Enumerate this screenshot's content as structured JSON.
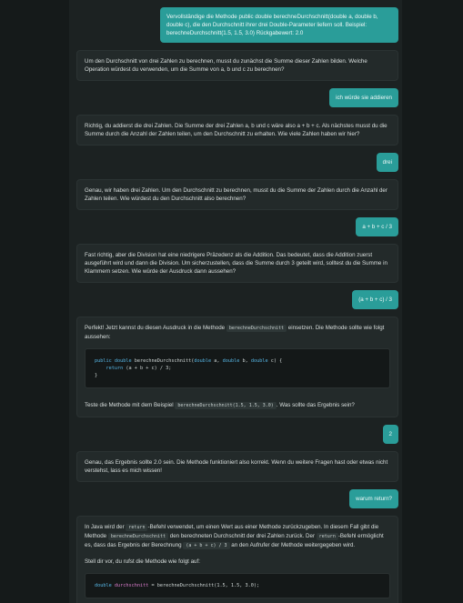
{
  "messages": [
    {
      "role": "user",
      "text": "Vervollständige die Methode public double berechneDurchschnitt(double a, double b, double c), die den Durchschnitt ihrer drei Double-Parameter liefern soll. Beispiel: berechneDurchschnitt(1.5, 1.5, 3.0) Rückgabewert: 2.0"
    },
    {
      "role": "assistant",
      "text": "Um den Durchschnitt von drei Zahlen zu berechnen, musst du zunächst die Summe dieser Zahlen bilden. Welche Operation würdest du verwenden, um die Summe von a, b und c zu berechnen?"
    },
    {
      "role": "user",
      "text": "ich würde sie addieren"
    },
    {
      "role": "assistant",
      "text": "Richtig, du addierst die drei Zahlen. Die Summe der drei Zahlen a, b und c wäre also a + b + c. Als nächstes musst du die Summe durch die Anzahl der Zahlen teilen, um den Durchschnitt zu erhalten. Wie viele Zahlen haben wir hier?"
    },
    {
      "role": "user",
      "text": "drei"
    },
    {
      "role": "assistant",
      "text": "Genau, wir haben drei Zahlen. Um den Durchschnitt zu berechnen, musst du die Summe der Zahlen durch die Anzahl der Zahlen teilen. Wie würdest du den Durchschnitt also berechnen?"
    },
    {
      "role": "user",
      "text": "a + b + c / 3"
    },
    {
      "role": "assistant",
      "text": "Fast richtig, aber die Division hat eine niedrigere Präzedenz als die Addition. Das bedeutet, dass die Addition zuerst ausgeführt wird und dann die Division. Um sicherzustellen, dass die Summe durch 3 geteilt wird, solltest du die Summe in Klammern setzen. Wie würde der Ausdruck dann aussehen?"
    },
    {
      "role": "user",
      "text": "(a + b + c) / 3"
    },
    {
      "role": "assistant",
      "p1_before": "Perfekt! Jetzt kannst du diesen Ausdruck in die Methode",
      "p1_code": "berechneDurchschnitt",
      "p1_after": "einsetzen. Die Methode sollte wie folgt aussehen:",
      "code": {
        "l1_kw": "public",
        "l1_ty": "double",
        "l1_name": "berechneDurchschnitt(",
        "l1_t1": "double",
        "l1_a": "a, ",
        "l1_t2": "double",
        "l1_b": "b, ",
        "l1_t3": "double",
        "l1_c": "c) {",
        "l2_kw": "return",
        "l2_expr": "(a + b + c) / 3;",
        "l3": "}"
      },
      "p2_before": "Teste die Methode mit dem Beispiel",
      "p2_code": "berechneDurchschnitt(1.5, 1.5, 3.0)",
      "p2_after": ". Was sollte das Ergebnis sein?"
    },
    {
      "role": "user",
      "text": "2"
    },
    {
      "role": "assistant",
      "text": "Genau, das Ergebnis sollte 2.0 sein. Die Methode funktioniert also korrekt. Wenn du weitere Fragen hast oder etwas nicht verstehst, lass es mich wissen!"
    },
    {
      "role": "user",
      "text": "warum return?"
    },
    {
      "role": "assistant",
      "p1_a": "In Java wird der",
      "p1_code1": "return",
      "p1_b": "-Befehl verwendet, um einen Wert aus einer Methode zurückzugeben. In diesem Fall gibt die Methode",
      "p1_code2": "berechneDurchschnitt",
      "p1_c": "den berechneten Durchschnitt der drei Zahlen zurück. Der",
      "p1_code3": "return",
      "p1_d": "-Befehl ermöglicht es, dass das Ergebnis der Berechnung",
      "p1_code4": "(a + b + c) / 3",
      "p1_e": "an den Aufrufer der Methode weitergegeben wird.",
      "p2": "Stell dir vor, du rufst die Methode wie folgt auf:",
      "code": {
        "ty": "double",
        "var": "durchschnitt",
        "rest": " = berechneDurchschnitt(1.5, 1.5, 3.0);"
      }
    }
  ]
}
